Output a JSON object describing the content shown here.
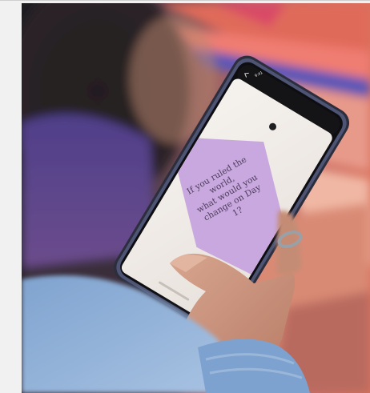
{
  "phone_screen": {
    "status_time": "9:41",
    "status_right": "",
    "prompt_lines": [
      "If you ruled the world,",
      "what would you",
      "change on Day 1?"
    ]
  },
  "colors": {
    "page_background": "#f1f1f1",
    "prompt_card": "#c9a8e0",
    "phone_frame": "#2c2e3d",
    "screen": "#f1eeea",
    "sweater": "#8fb0d6"
  },
  "icons": {
    "phone_back": "chevron-left-icon",
    "phone_dot": "dot-icon"
  }
}
